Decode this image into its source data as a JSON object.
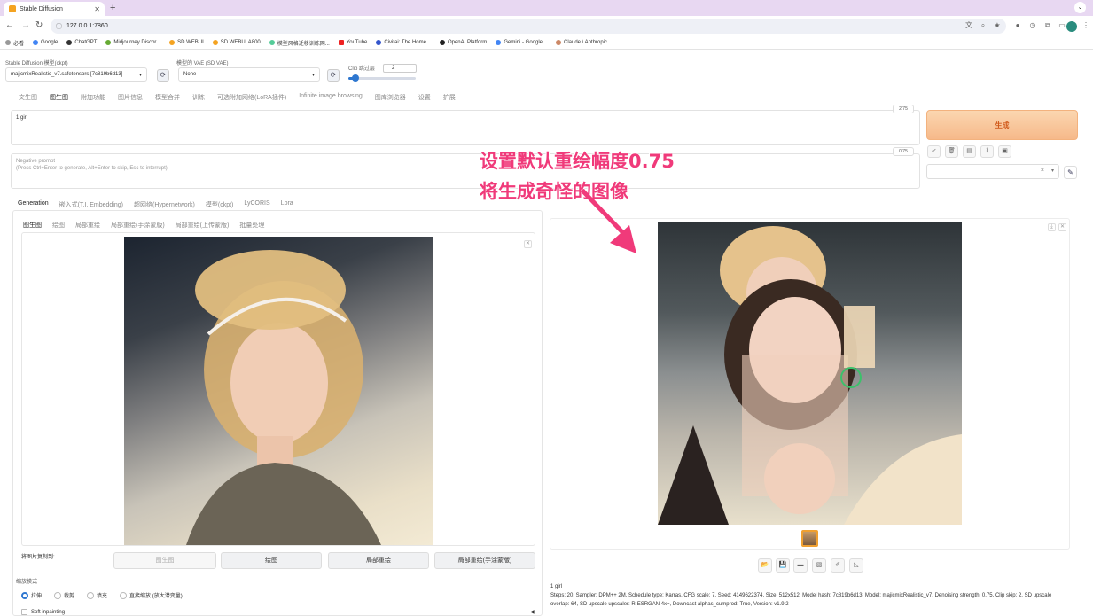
{
  "browser": {
    "tab_title": "Stable Diffusion",
    "url": "127.0.0.1:7860",
    "bookmarks": [
      "必看",
      "Google",
      "ChatGPT",
      "Midjourney Discor...",
      "SD WEBUI",
      "SD WEBUI A800",
      "模型风格迁移训练网...",
      "YouTube",
      "Civitai: The Home...",
      "OpenAI Platform",
      "Gemini - Google...",
      "Claude \\ Anthropic"
    ]
  },
  "settings": {
    "checkpoint_label": "Stable Diffusion 模型(ckpt)",
    "checkpoint_value": "majicmixRealistic_v7.safetensors [7c819b6d13]",
    "vae_label": "模型的 VAE (SD VAE)",
    "vae_value": "None",
    "clip_label": "Clip 跳过层",
    "clip_value": "2"
  },
  "main_tabs": [
    "文生图",
    "图生图",
    "附加功能",
    "图片信息",
    "模型合并",
    "训练",
    "可选附加网络(LoRA插件)",
    "Infinite image browsing",
    "图库浏览器",
    "设置",
    "扩展"
  ],
  "prompt": {
    "positive": "1 girl",
    "positive_count": "2/75",
    "negative_label": "Negative prompt",
    "negative_placeholder": "(Press Ctrl+Enter to generate, Alt+Enter to skip, Esc to interrupt)",
    "negative_count": "0/75"
  },
  "generate_label": "生成",
  "network_tabs": [
    "Generation",
    "嵌入式(T.I. Embedding)",
    "超网络(Hypernetwork)",
    "模型(ckpt)",
    "LyCORIS",
    "Lora"
  ],
  "img2img_tabs": [
    "图生图",
    "绘图",
    "局部重绘",
    "局部重绘(手涂蒙版)",
    "局部重绘(上传蒙版)",
    "批量处理"
  ],
  "copy_to_label": "将图片复制到:",
  "copy_buttons": [
    "图生图",
    "绘图",
    "局部重绘",
    "局部重绘(手涂蒙版)"
  ],
  "resize_mode": {
    "label": "缩放模式",
    "options": [
      "拉伸",
      "裁剪",
      "填充",
      "直接缩放 (放大潜变量)"
    ],
    "selected": "拉伸"
  },
  "soft_inpainting_label": "Soft inpainting",
  "annotation": {
    "line1": "设置默认重绘幅度0.75",
    "line2": "将生成奇怪的图像",
    "color": "#f03a7a"
  },
  "generation_info": {
    "prompt": "1 girl",
    "params": "Steps: 20, Sampler: DPM++ 2M, Schedule type: Karras, CFG scale: 7, Seed: 4149622374, Size: 512x512, Model hash: 7c819b6d13, Model: majicmixRealistic_v7, Denoising strength: 0.75, Clip skip: 2, SD upscale overlap: 64, SD upscale upscaler: R-ESRGAN 4x+, Downcast alphas_cumprod: True, Version: v1.9.2"
  },
  "colors": {
    "accent": "#2e77d0",
    "generate_bg": "#f6b98a",
    "generate_text": "#d0591a"
  }
}
